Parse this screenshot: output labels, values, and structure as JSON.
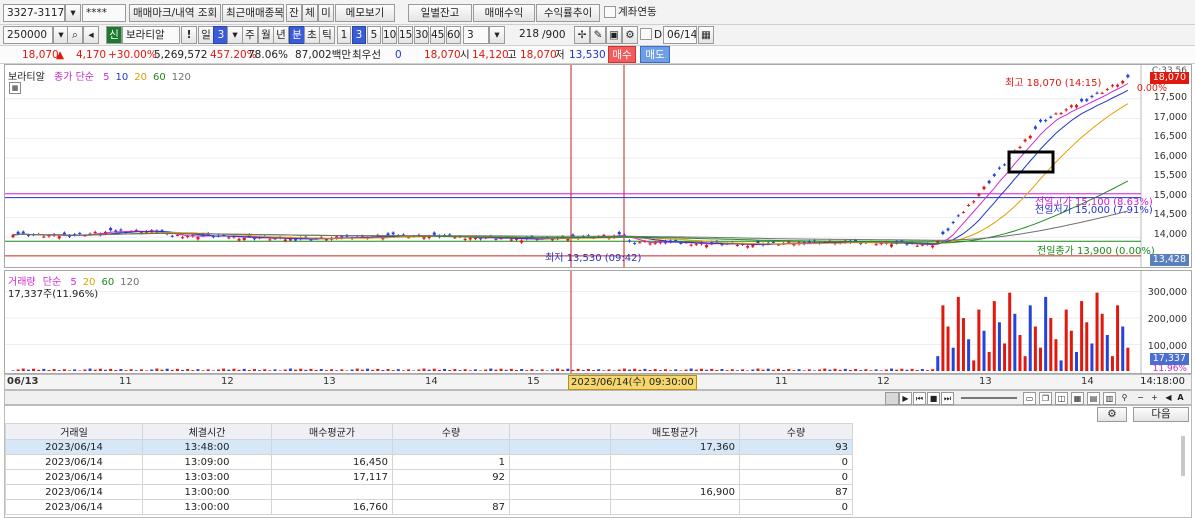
{
  "toolbar1": {
    "stock_code": "3327-3117",
    "masked": "****",
    "trade_mark_button": "매매마크/내역 조회",
    "recent_button": "최근매매종목",
    "tab_jan": "잔",
    "tab_che": "체",
    "tab_mi": "미",
    "memo_button": "메모보기",
    "daily_balance_button": "일별잔고",
    "trade_profit_button": "매매수익",
    "profit_trend_button": "수익률추이",
    "account_link_label": "계좌연동"
  },
  "toolbar2": {
    "code_value": "250000",
    "sin_badge": "신",
    "stock_name": "보라티알",
    "exclaim": "!",
    "period_day": "일",
    "period_day_count": "3",
    "period_week": "주",
    "period_month": "월",
    "period_year": "년",
    "period_min": "분",
    "period_sec": "초",
    "period_tick": "틱",
    "intervals": [
      "1",
      "3",
      "5",
      "10",
      "15",
      "30",
      "45",
      "60"
    ],
    "interval_selected": "3",
    "count_value": "3",
    "view_count": "218",
    "view_total": "/900",
    "date_prefix": "D",
    "date_value": "06/14"
  },
  "toolbar3": {
    "price": "18,070",
    "change": "4,170",
    "change_pct": "+30.00%",
    "volume": "5,269,572",
    "volume_ratio": "457.20%",
    "turnover_ratio": "78.06%",
    "amount": "87,002백만",
    "priority_label": "최우선",
    "priority_value": "0",
    "price2": "18,070",
    "open_label": "시",
    "open": "14,120",
    "high_label": "고",
    "high": "18,070",
    "low_label": "저",
    "low": "13,530",
    "buy_button": "매수",
    "sell_button": "매도"
  },
  "price_chart": {
    "stock_label": "보라티알",
    "ma_label": "종가 단순",
    "ma_periods": [
      "5",
      "10",
      "20",
      "60",
      "120"
    ],
    "ma_colors": [
      "#d22bd2",
      "#2233cc",
      "#e0a000",
      "#1f8a1f",
      "#707070"
    ],
    "max_note": "최고 18,070 (14:15)",
    "min_note": "최저 13,530 (09:42)",
    "ref1_note": "전일종가 13,900 (0.00%)",
    "ref2_note": "전일저가 15,000 (7.91%)",
    "ref3_note": "전일고가 15,100 (8.63%)",
    "price_axis": [
      "17,500",
      "17,000",
      "16,500",
      "16,000",
      "15,500",
      "15,000",
      "14,500",
      "14,000"
    ],
    "axis_top": "C:33.56",
    "current_tag": "18,070",
    "pct_tag": "0.00%",
    "low_tag": "13,428"
  },
  "volume_chart": {
    "label": "거래량",
    "ma_label": "단순",
    "ma_periods": [
      "5",
      "20",
      "60",
      "120"
    ],
    "current_note": "17,337주(11.96%)",
    "axis": [
      "300,000",
      "200,000",
      "100,000"
    ],
    "current_tag": "17,337",
    "pct_tag": "11.96%"
  },
  "time_axis": {
    "ticks": [
      "06/13",
      "11",
      "12",
      "13",
      "14",
      "15",
      "10",
      "11",
      "12",
      "13",
      "14"
    ],
    "cursor_label": "2023/06/14(수) 09:30:00",
    "end_label": "14:18:00"
  },
  "table": {
    "next_button": "다음",
    "headers": [
      "거래일",
      "체결시간",
      "매수평균가",
      "수량",
      "",
      "매도평균가",
      "수량"
    ],
    "rows": [
      {
        "date": "2023/06/14",
        "time": "13:48:00",
        "buy_avg": "",
        "buy_qty": "",
        "blank": "",
        "sell_avg": "17,360",
        "sell_qty": "93"
      },
      {
        "date": "2023/06/14",
        "time": "13:09:00",
        "buy_avg": "16,450",
        "buy_qty": "1",
        "blank": "",
        "sell_avg": "",
        "sell_qty": "0"
      },
      {
        "date": "2023/06/14",
        "time": "13:03:00",
        "buy_avg": "17,117",
        "buy_qty": "92",
        "blank": "",
        "sell_avg": "",
        "sell_qty": "0"
      },
      {
        "date": "2023/06/14",
        "time": "13:00:00",
        "buy_avg": "",
        "buy_qty": "",
        "blank": "",
        "sell_avg": "16,900",
        "sell_qty": "87"
      },
      {
        "date": "2023/06/14",
        "time": "13:00:00",
        "buy_avg": "16,760",
        "buy_qty": "87",
        "blank": "",
        "sell_avg": "",
        "sell_qty": "0"
      }
    ]
  }
}
